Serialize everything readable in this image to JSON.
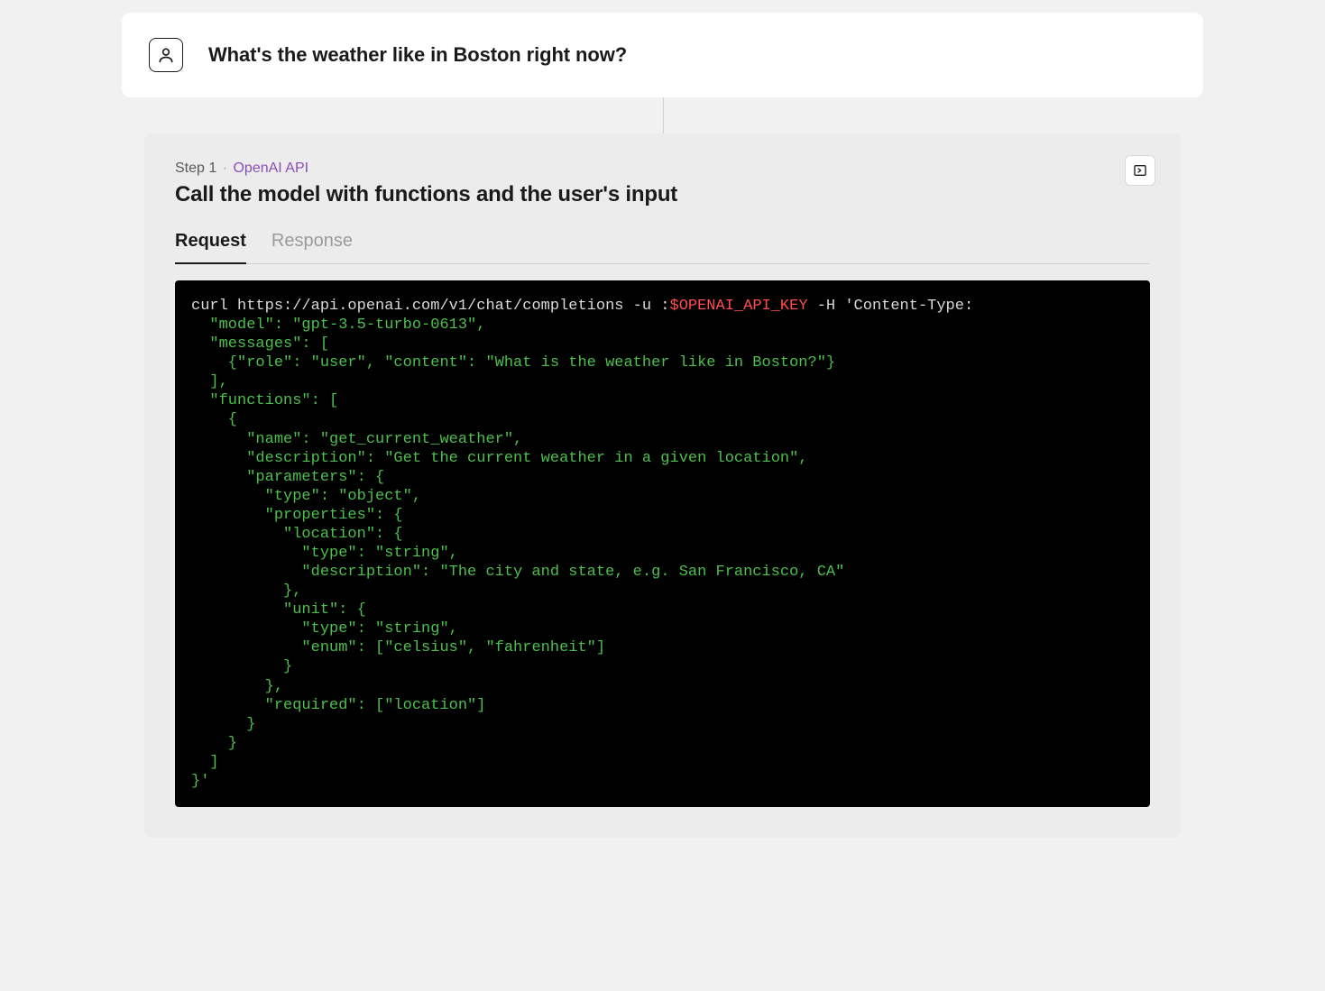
{
  "user_message": "What's the weather like in Boston right now?",
  "step": {
    "label_prefix": "Step 1",
    "label_api": "OpenAI API",
    "title": "Call the model with functions and the user's input"
  },
  "tabs": {
    "request": "Request",
    "response": "Response"
  },
  "code": {
    "cmd": "curl https://api.openai.com/v1/chat/completions -u :",
    "var": "$OPENAI_API_KEY",
    "after_var": " -H 'Content-Type:",
    "body": "  \"model\": \"gpt-3.5-turbo-0613\",\n  \"messages\": [\n    {\"role\": \"user\", \"content\": \"What is the weather like in Boston?\"}\n  ],\n  \"functions\": [\n    {\n      \"name\": \"get_current_weather\",\n      \"description\": \"Get the current weather in a given location\",\n      \"parameters\": {\n        \"type\": \"object\",\n        \"properties\": {\n          \"location\": {\n            \"type\": \"string\",\n            \"description\": \"The city and state, e.g. San Francisco, CA\"\n          },\n          \"unit\": {\n            \"type\": \"string\",\n            \"enum\": [\"celsius\", \"fahrenheit\"]\n          }\n        },\n        \"required\": [\"location\"]\n      }\n    }\n  ]\n}'"
  }
}
